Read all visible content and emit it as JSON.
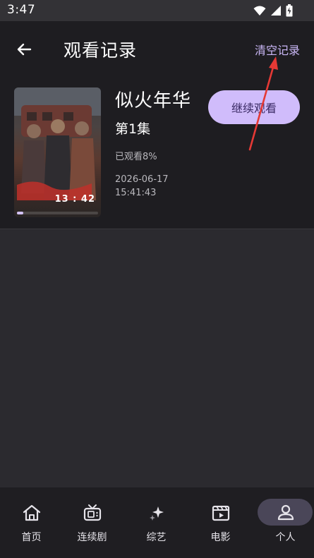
{
  "status_bar": {
    "time": "3:47"
  },
  "header": {
    "title": "观看记录",
    "clear_label": "清空记录"
  },
  "record": {
    "title": "似火年华",
    "episode": "第1集",
    "watched": "已观看8%",
    "watched_fraction": 0.08,
    "date": "2026-06-17",
    "time": "15:41:43",
    "duration": "13 : 42",
    "continue_label": "继续观看"
  },
  "nav": {
    "items": [
      {
        "label": "首页",
        "icon": "home-icon"
      },
      {
        "label": "连续剧",
        "icon": "tv-icon"
      },
      {
        "label": "综艺",
        "icon": "sparkle-icon"
      },
      {
        "label": "电影",
        "icon": "clapperboard-icon"
      },
      {
        "label": "个人",
        "icon": "person-icon",
        "active": true
      }
    ]
  },
  "colors": {
    "accent": "#d0bcfb",
    "accent_text": "#cbb8f7",
    "background": "#2b2a2f",
    "surface": "#1e1d21",
    "annotation": "#e53935"
  }
}
